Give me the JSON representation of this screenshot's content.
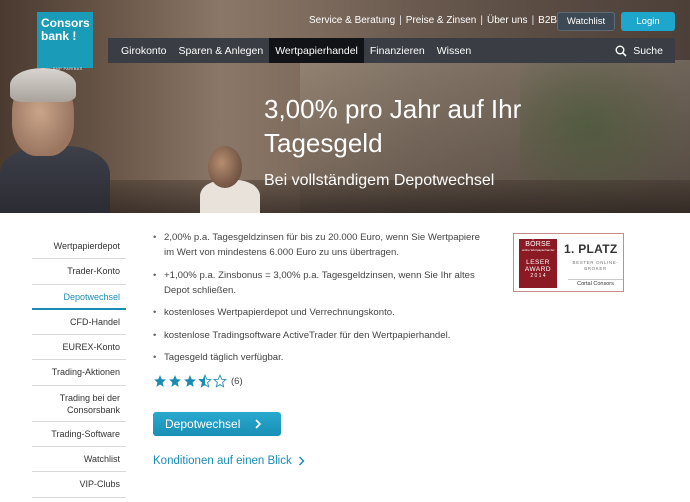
{
  "brand": {
    "logo_line1": "Consors",
    "logo_line2": "bank !",
    "logo_tagline": "BNP PARIBAS"
  },
  "topnav": {
    "items": [
      "Service & Beratung",
      "Preise & Zinsen",
      "Über uns",
      "B2B"
    ],
    "separator": "|"
  },
  "header_buttons": {
    "watchlist": "Watchlist",
    "login": "Login"
  },
  "mainnav": {
    "items": [
      "Girokonto",
      "Sparen & Anlegen",
      "Wertpapierhandel",
      "Finanzieren",
      "Wissen"
    ],
    "active_index": 2,
    "search_label": "Suche"
  },
  "hero": {
    "headline": "3,00% pro Jahr auf Ihr Tagesgeld",
    "subline": "Bei vollständigem Depotwechsel"
  },
  "sidebar": {
    "items": [
      "Wertpapierdepot",
      "Trader-Konto",
      "Depotwechsel",
      "CFD-Handel",
      "EUREX-Konto",
      "Trading-Aktionen",
      "Trading bei der Consorsbank",
      "Trading-Software",
      "Watchlist",
      "VIP-Clubs"
    ],
    "active_index": 2
  },
  "bullets": [
    "2,00% p.a. Tagesgeldzinsen für bis zu 20.000 Euro, wenn Sie Wertpapiere im Wert von mindestens 6.000 Euro zu uns übertragen.",
    "+1,00% p.a. Zinsbonus = 3,00% p.a. Tagesgeldzinsen, wenn Sie Ihr altes Depot schließen.",
    "kostenloses Wertpapierdepot und Verrechnungskonto.",
    "kostenlose Tradingsoftware ActiveTrader für den Wertpapierhandel.",
    "Tagesgeld täglich verfügbar."
  ],
  "rating": {
    "stars_filled": 3.5,
    "stars_total": 5,
    "count": "(6)"
  },
  "cta": {
    "primary_label": "Depotwechsel",
    "conditions_link": "Konditionen auf einen Blick"
  },
  "award": {
    "box_title": "BÖRSE",
    "box_sub": "online Wertpapierhandel",
    "box_line1": "LESER",
    "box_line2": "AWARD",
    "box_year": "2 0 1 4",
    "rank": "1. PLATZ",
    "category": "BESTER ONLINE-BROKER",
    "winner": "Cortal Consors"
  },
  "colors": {
    "accent": "#1a9bb8",
    "nav_bg": "#3a3e44",
    "nav_active": "#111316",
    "link": "#1a8cb3",
    "award_red": "#8b1a24"
  }
}
